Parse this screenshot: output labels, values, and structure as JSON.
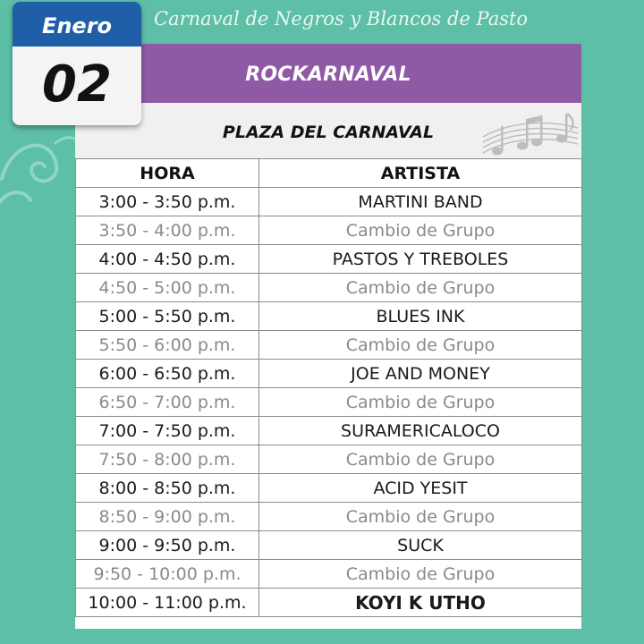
{
  "banner": {
    "title": "Carnaval de Negros y Blancos de Pasto"
  },
  "date": {
    "month": "Enero",
    "day": "02"
  },
  "event": {
    "name": "ROCKARNAVAL",
    "venue": "PLAZA DEL CARNAVAL"
  },
  "schedule": {
    "headers": {
      "time": "HORA",
      "artist": "ARTISTA"
    },
    "rows": [
      {
        "time": "3:00 - 3:50 p.m.",
        "artist": "MARTINI BAND",
        "kind": "act"
      },
      {
        "time": "3:50 - 4:00 p.m.",
        "artist": "Cambio de Grupo",
        "kind": "change"
      },
      {
        "time": "4:00 - 4:50 p.m.",
        "artist": "PASTOS Y TREBOLES",
        "kind": "act"
      },
      {
        "time": "4:50 - 5:00 p.m.",
        "artist": "Cambio de Grupo",
        "kind": "change"
      },
      {
        "time": "5:00 - 5:50 p.m.",
        "artist": "BLUES INK",
        "kind": "act"
      },
      {
        "time": "5:50 - 6:00 p.m.",
        "artist": "Cambio de Grupo",
        "kind": "change"
      },
      {
        "time": "6:00 - 6:50 p.m.",
        "artist": "JOE AND MONEY",
        "kind": "act"
      },
      {
        "time": "6:50 - 7:00 p.m.",
        "artist": "Cambio de Grupo",
        "kind": "change"
      },
      {
        "time": "7:00 - 7:50 p.m.",
        "artist": "SURAMERICALOCO",
        "kind": "act"
      },
      {
        "time": "7:50 - 8:00 p.m.",
        "artist": "Cambio de Grupo",
        "kind": "change"
      },
      {
        "time": "8:00 - 8:50 p.m.",
        "artist": "ACID YESIT",
        "kind": "act"
      },
      {
        "time": "8:50 - 9:00 p.m.",
        "artist": "Cambio de Grupo",
        "kind": "change"
      },
      {
        "time": "9:00 - 9:50 p.m.",
        "artist": "SUCK",
        "kind": "act"
      },
      {
        "time": "9:50 - 10:00 p.m.",
        "artist": "Cambio de Grupo",
        "kind": "change"
      },
      {
        "time": "10:00 - 11:00 p.m.",
        "artist": "KOYI K UTHO",
        "kind": "act"
      }
    ]
  },
  "icons": {
    "decoration": "music-notes-icon",
    "ornament": "swirl-ornament"
  },
  "colors": {
    "background": "#5cbfa6",
    "header": "#8f59a5",
    "month_band": "#1f5fa8",
    "change_text": "#8a8a8a"
  }
}
